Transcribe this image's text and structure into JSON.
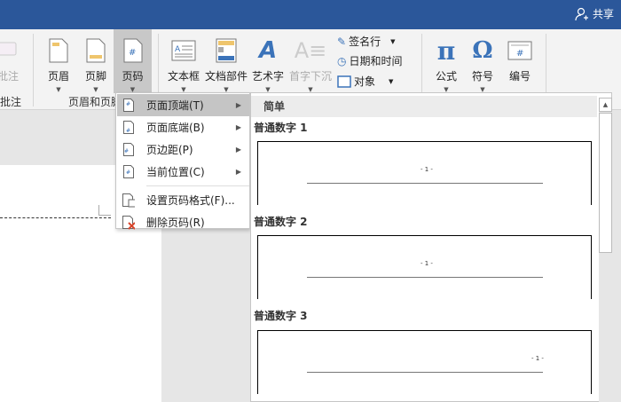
{
  "titlebar": {
    "share": "共享"
  },
  "ribbon": {
    "comment": "批注",
    "comment_group": "批注",
    "header": "页眉",
    "footer": "页脚",
    "page_number": "页码",
    "header_footer_group": "页眉和页脚",
    "textbox": "文本框",
    "quick_parts": "文档部件",
    "wordart": "艺术字",
    "drop_cap": "首字下沉",
    "signature_line": "签名行",
    "date_time": "日期和时间",
    "object": "对象",
    "equation": "公式",
    "symbol": "符号",
    "number": "编号"
  },
  "menu": {
    "items": [
      {
        "label": "页面顶端(T)",
        "submenu": true
      },
      {
        "label": "页面底端(B)",
        "submenu": true
      },
      {
        "label": "页边距(P)",
        "submenu": true
      },
      {
        "label": "当前位置(C)",
        "submenu": true
      },
      {
        "label": "设置页码格式(F)..."
      },
      {
        "label": "删除页码(R)"
      }
    ]
  },
  "gallery": {
    "header": "简单",
    "items": [
      {
        "label": "普通数字 1",
        "preview": "- 1 -",
        "align": "center"
      },
      {
        "label": "普通数字 2",
        "preview": "- 1 -",
        "align": "center"
      },
      {
        "label": "普通数字 3",
        "preview": "- 1 -",
        "align": "right"
      }
    ]
  },
  "colors": {
    "title_bar": "#2b579a",
    "accent_blue": "#3b73b9",
    "highlight": "#c5c5c5"
  }
}
